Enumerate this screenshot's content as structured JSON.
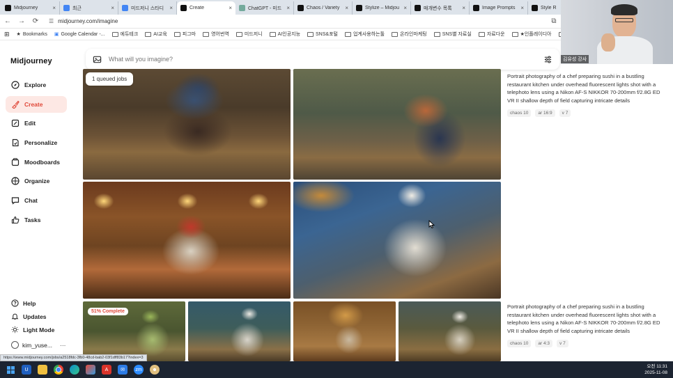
{
  "browser": {
    "tabs": [
      {
        "title": "Midjourney",
        "color": "#111111",
        "active": false
      },
      {
        "title": "최근",
        "color": "#4285f4",
        "active": false
      },
      {
        "title": "미드저니 스타디",
        "color": "#4285f4",
        "active": false
      },
      {
        "title": "Create",
        "color": "#111111",
        "active": true
      },
      {
        "title": "ChatGPT - 미드",
        "color": "#74aa9c",
        "active": false
      },
      {
        "title": "Chaos / Variety",
        "color": "#111111",
        "active": false
      },
      {
        "title": "Stylize – Midjou",
        "color": "#111111",
        "active": false
      },
      {
        "title": "매개변수 목록",
        "color": "#111111",
        "active": false
      },
      {
        "title": "Image Prompts",
        "color": "#111111",
        "active": false
      },
      {
        "title": "Style R",
        "color": "#111111",
        "active": false
      }
    ],
    "url": "midjourney.com/imagine",
    "bookmarks": [
      "Bookmarks",
      "Google Calendar -...",
      "에듀테크",
      "AI교육",
      "피그마",
      "영어번역",
      "미드저니",
      "AI인공지능",
      "SNS&포털",
      "업계사용하는툴",
      "온라인마케팅",
      "SNS별 자료실",
      "자료다운",
      "★인플레이디아",
      "온라인강의"
    ]
  },
  "sidebar": {
    "logo": "Midjourney",
    "items": [
      {
        "label": "Explore",
        "icon": "compass-icon",
        "active": false
      },
      {
        "label": "Create",
        "icon": "brush-icon",
        "active": true
      },
      {
        "label": "Edit",
        "icon": "edit-icon",
        "active": false
      },
      {
        "label": "Personalize",
        "icon": "personalize-icon",
        "active": false
      },
      {
        "label": "Moodboards",
        "icon": "moodboard-icon",
        "active": false
      },
      {
        "label": "Organize",
        "icon": "grid-icon",
        "active": false
      },
      {
        "label": "Chat",
        "icon": "chat-icon",
        "active": false
      },
      {
        "label": "Tasks",
        "icon": "thumbs-up-icon",
        "active": false
      }
    ],
    "bottom": [
      {
        "label": "Help",
        "icon": "help-icon"
      },
      {
        "label": "Updates",
        "icon": "bell-icon"
      },
      {
        "label": "Light Mode",
        "icon": "sun-icon"
      }
    ],
    "user": "kim_yuse...",
    "user_menu": "···"
  },
  "search": {
    "placeholder": "What will you imagine?"
  },
  "queue": {
    "label": "1 queued jobs"
  },
  "prompts": [
    {
      "text": "Portrait photography of a chef preparing sushi in a bustling restaurant kitchen under overhead fluorescent lights shot with a telephoto lens using a Nikon AF-S NIKKOR 70-200mm f/2.8G ED VR II shallow depth of field capturing intricate details",
      "params": [
        "chaos 10",
        "ar 16:9",
        "v 7"
      ]
    },
    {
      "text": "Portrait photography of a chef preparing sushi in a bustling restaurant kitchen under overhead fluorescent lights shot with a telephoto lens using a Nikon AF-S NIKKOR 70-200mm f/2.8G ED VR II shallow depth of field capturing intricate details",
      "params": [
        "chaos 10",
        "ar 4:3",
        "v 7"
      ]
    }
  ],
  "job": {
    "progress_label": "51% Complete",
    "progress": 51
  },
  "webcam": {
    "label": "김유성 강사"
  },
  "status_url": "https://www.midjourney.com/jobs/a2518fdc-3fb0-48cd-bab2-03f1dff83b17?index=3",
  "clock": {
    "time": "오전 11:31",
    "date": "2025-11-08"
  },
  "colors": {
    "accent": "#e0493a",
    "accent_bg": "#fde8e4"
  }
}
